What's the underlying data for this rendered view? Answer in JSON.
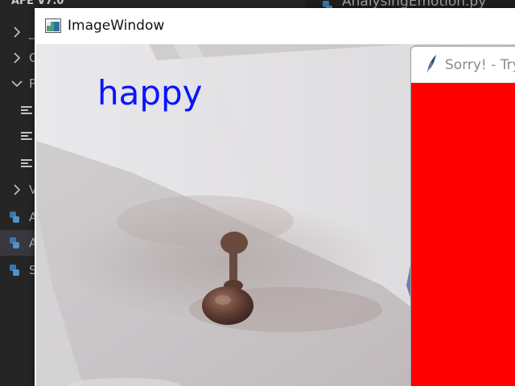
{
  "explorer": {
    "title": "AFE V7.0",
    "rows": [
      {
        "kind": "folder-collapsed",
        "label": "_"
      },
      {
        "kind": "folder-collapsed",
        "label": "C"
      },
      {
        "kind": "folder-expanded",
        "label": "P"
      },
      {
        "kind": "file",
        "label": ""
      },
      {
        "kind": "file",
        "label": ""
      },
      {
        "kind": "file",
        "label": ""
      },
      {
        "kind": "folder-collapsed",
        "label": "V"
      },
      {
        "kind": "python",
        "label": "A"
      },
      {
        "kind": "python",
        "label": "A"
      },
      {
        "kind": "python",
        "label": "S"
      }
    ]
  },
  "editor_tab": {
    "label": "AnalysingEmotion.py"
  },
  "image_window": {
    "title": "ImageWindow",
    "emotion_label": "happy",
    "emotion_color": "#0a14ff"
  },
  "sorry_window": {
    "title": "Sorry! - Try",
    "body_color": "#ff0000"
  }
}
